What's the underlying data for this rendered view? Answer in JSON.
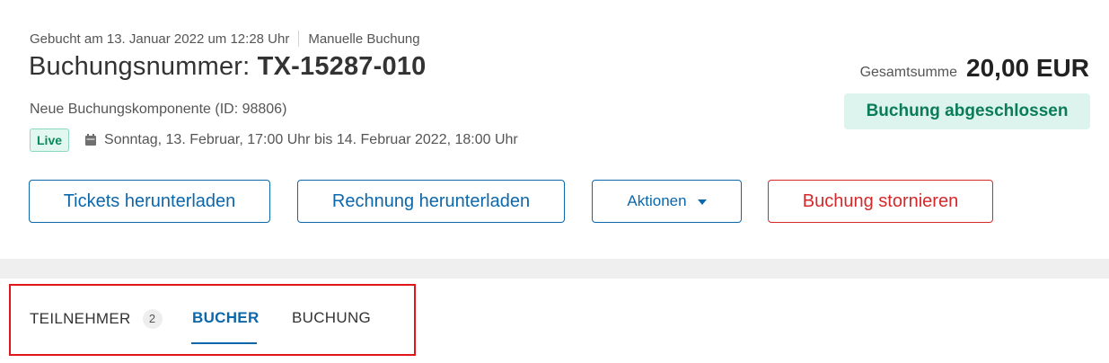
{
  "booking": {
    "booked_at": "Gebucht am 13. Januar 2022 um 12:28 Uhr",
    "booking_type": "Manuelle Buchung",
    "number_label": "Buchungsnummer:",
    "number": "TX-15287-010",
    "component": "Neue Buchungskomponente (ID: 98806)",
    "live_badge": "Live",
    "date_range": "Sonntag, 13. Februar, 17:00 Uhr bis 14. Februar 2022, 18:00 Uhr",
    "date_icon": "calendar-icon"
  },
  "summary": {
    "total_label": "Gesamtsumme",
    "total_amount": "20,00 EUR",
    "status": "Buchung abgeschlossen"
  },
  "actions": {
    "download_tickets": "Tickets herunterladen",
    "download_invoice": "Rechnung herunterladen",
    "more_actions": "Aktionen",
    "cancel_booking": "Buchung stornieren"
  },
  "tabs": [
    {
      "label": "TEILNEHMER",
      "count": "2"
    },
    {
      "label": "BUCHER",
      "active": true
    },
    {
      "label": "BUCHUNG"
    }
  ],
  "colors": {
    "primary": "#0c67ab",
    "danger": "#d4292b",
    "success": "#0a7d56",
    "highlight": "#e0161a"
  }
}
